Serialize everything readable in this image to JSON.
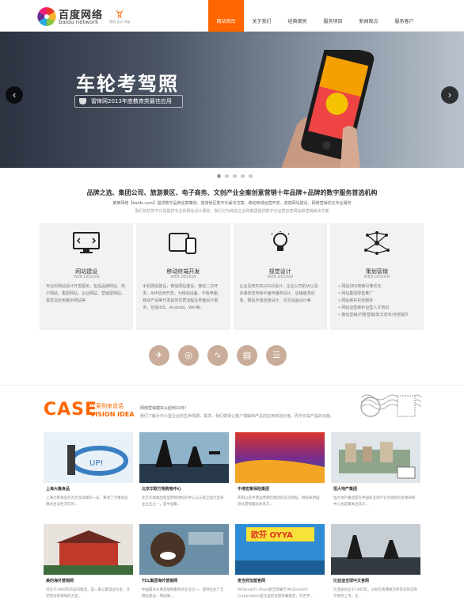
{
  "logo": {
    "name_cn": "百度网络",
    "name_en": "baidu network",
    "side_text": "营销 设计 网络"
  },
  "nav": {
    "items": [
      "网站首页",
      "关于我们",
      "经典案例",
      "服务项目",
      "新闻观点",
      "服务客户"
    ]
  },
  "banner": {
    "title": "车轮考驾照",
    "badge": "雷锋网2013年度教育类最佳应用",
    "arrow_left": "‹",
    "arrow_right": "›"
  },
  "intro": {
    "title": "品牌之选、集团公司、旅游景区、电子商务、文创产业全案创意营销十年品牌+品牌的数字服务首选机构",
    "sub": "某某网络【baidu.com】提供数字品牌全案策划、旅游景区数字化解决方案、移动商城运营开发、高端网站建设、网络营销优化专业服务",
    "sub2": "我们的优势不只是提供专业的网站设计服务，我们已为知名企业和集团提供数字化运营创意网站和营销解决方案"
  },
  "services": [
    {
      "title": "网站建设",
      "en": "WEB DESIGN",
      "desc": "专业的网站设计开发服务，包括品牌网站、商户网站、集团网站、企业网站、营销型网站、视觉及应用展示网站等"
    },
    {
      "title": "移动终端开发",
      "en": "WEB DESIGN",
      "desc": "手机网站建设，微信网站建设，微信二次开发，APP应用开发，为移动设备、平板电脑、移动产品等开发提供优质流程及界面设计服务，包括iOS、Android、Win等。"
    },
    {
      "title": "视觉设计",
      "en": "WEB DESIGN",
      "desc": "企业及软件的LOGO设计，企业公司的VI以及多媒体宣传和平面传播类设计，店铺装潢创意，网站专题包装设计，交互动画设计等"
    },
    {
      "title": "策划营销",
      "en": "WEB DESIGN",
      "list": [
        "网站SEO搜索引擎优化",
        "网站集团零售推广",
        "网站维护托管服务",
        "网站运营维护运营人才培训",
        "微信营销/问答营销/软文发布/信誉提升"
      ]
    }
  ],
  "circles": [
    "✈",
    "◎",
    "∿",
    "▤",
    "☰"
  ],
  "case_section": {
    "logo": "CASE",
    "sub1": "让案例来说话",
    "sub2": "VISION IDEA",
    "text1": "网络营销模块从起到10年！",
    "text2": "我们了解大中小型企业的生命周期，需求，我们做得让客户理解和产品的应用体验价值，而不仅是产品的功能。"
  },
  "cases": [
    {
      "title": "上海大隆食品",
      "desc": "上海大隆食品作为大连高端的一员，秉承了大隆食品模式合法性方向的..."
    },
    {
      "title": "北京华联万物购物中心",
      "desc": "北京华联集团新型购物地标的中心与五家全国大型商业企业之一，是中国集..."
    },
    {
      "title": "中港宏聚保险集团",
      "desc": "庆阳以是中港运营保险集团的首次网站，网站采用国际化营销理念体系方..."
    },
    {
      "title": "恒大地产集团",
      "desc": "恒大地产集团是在中国商业地产业务规划的主要研发中心也是最关注其大..."
    },
    {
      "title": "美的海外营销网",
      "desc": "创立于1968年的美的集团，是一家以家电业为主，涉足物流等领域的大型..."
    },
    {
      "title": "TCL集团海外营销网",
      "desc": "中国最早从事互联网服务的企业之一，提供企业广告网站建设，网站服..."
    },
    {
      "title": "麦当劳加盟官网",
      "desc": "McDonald's Plaza麦当劳餐厅(McDonald's Corporation)是大型的连锁快餐集团，在世界..."
    },
    {
      "title": "比亚迪全球中文官网",
      "desc": "比亚迪创立于1995年，分别在香港联交所及深圳证券交易所上市，主..."
    }
  ]
}
